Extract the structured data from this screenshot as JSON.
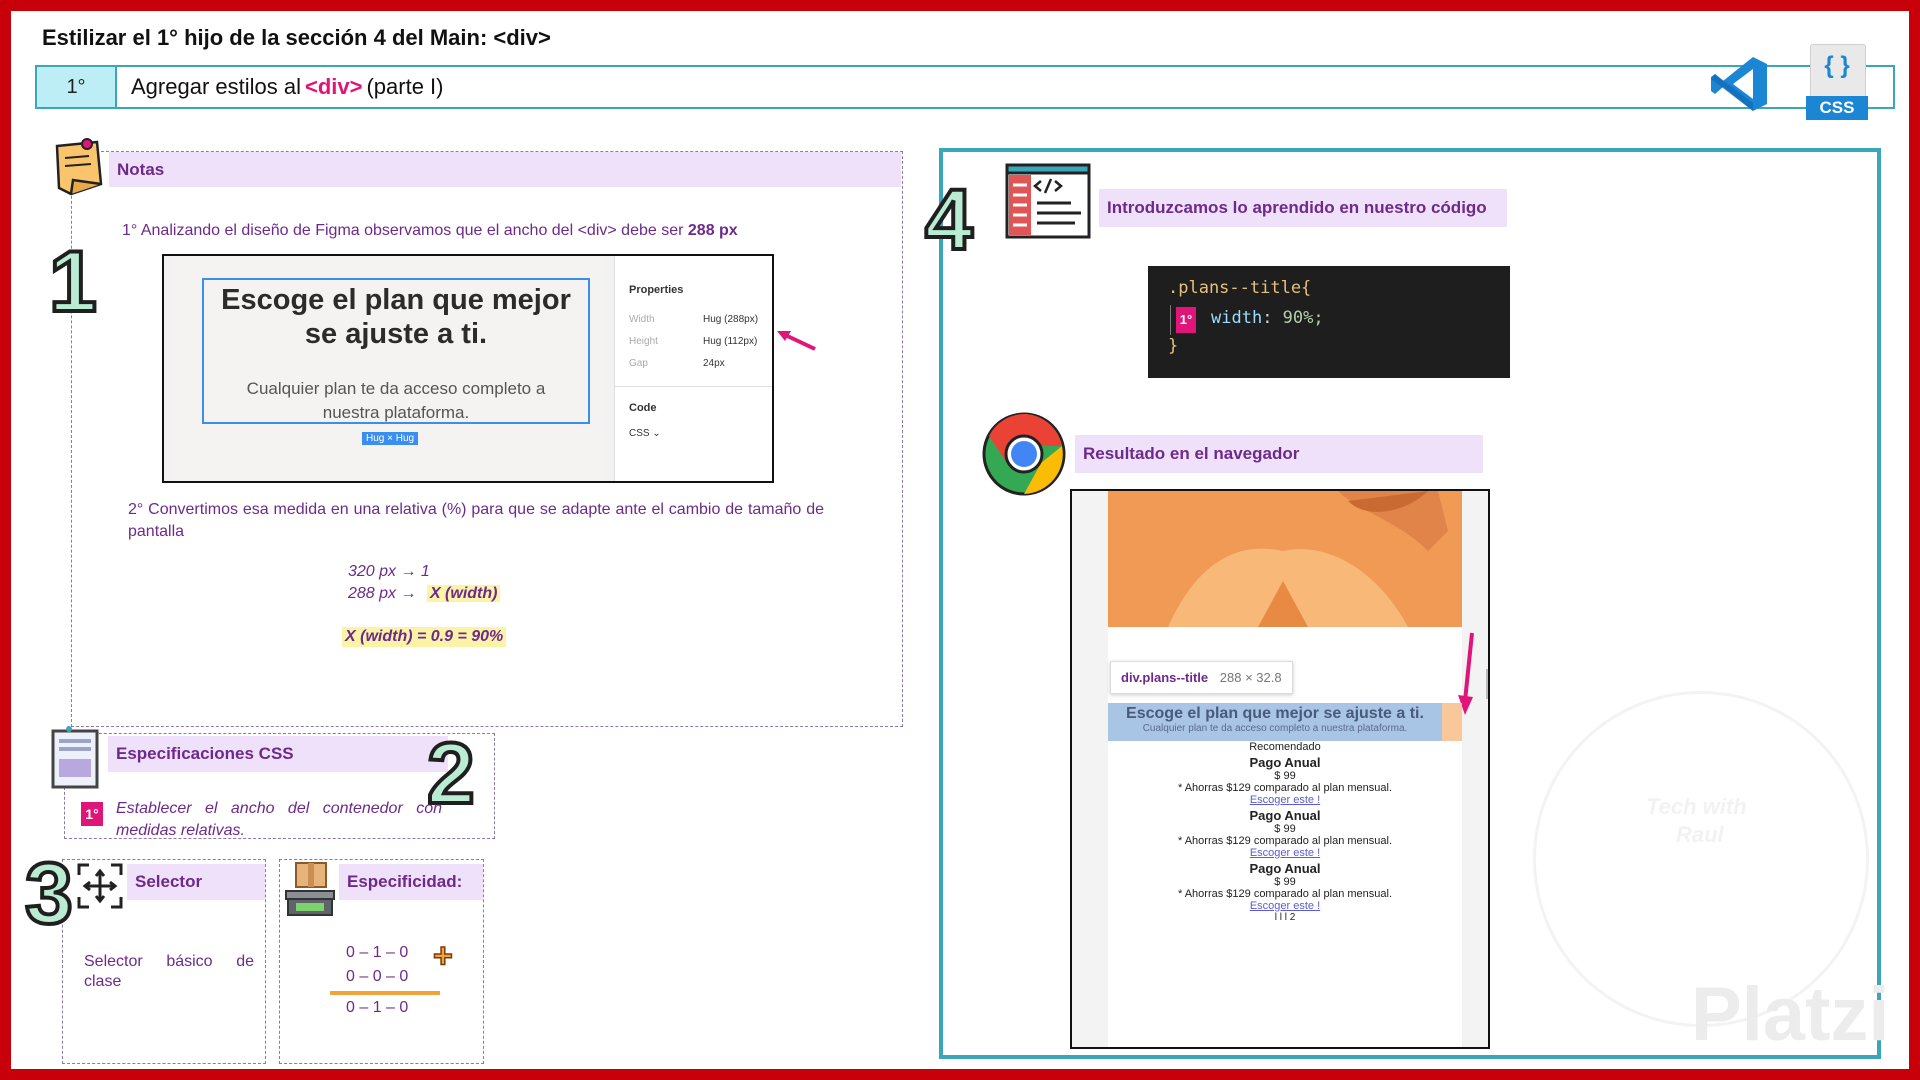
{
  "header": {
    "title": "Estilizar el 1° hijo de la sección 4 del Main: <div>",
    "step": "1°",
    "subtitle_pre": "Agregar estilos al",
    "subtitle_tag": "<div>",
    "subtitle_post": "(parte I)",
    "css_badge": "CSS",
    "css_braces": "{ }"
  },
  "notes": {
    "label": "Notas",
    "section_number": "1",
    "point1": "1° Analizando el diseño de Figma observamos que el ancho del <div> debe ser",
    "point1_value": "288 px",
    "point2": "2° Convertimos esa medida en una relativa (%) para que se adapte ante el cambio de tamaño de pantalla",
    "calc_line1": "320 px → 1",
    "calc_line2_left": "288 px →",
    "calc_line2_right": "X (width)",
    "calc_result": "X (width) = 0.9 = 90%"
  },
  "figma": {
    "heading": "Escoge el plan que mejor se ajuste a ti.",
    "paragraph": "Cualquier plan te da acceso completo a nuestra plataforma.",
    "tag": "Hug × Hug",
    "properties_title": "Properties",
    "width_label": "Width",
    "width_value": "Hug (288px)",
    "height_label": "Height",
    "height_value": "Hug (112px)",
    "gap_label": "Gap",
    "gap_value": "24px",
    "code_title": "Code",
    "code_lang": "CSS ⌄"
  },
  "specs": {
    "label": "Especificaciones CSS",
    "section_number": "2",
    "badge": "1°",
    "text": "Establecer el ancho del contenedor con medidas relativas."
  },
  "selector": {
    "label": "Selector",
    "section_number": "3",
    "text": "Selector básico de clase"
  },
  "specificity": {
    "label": "Especificidad:",
    "row1": "0 – 1 – 0",
    "row2": "0 – 0 – 0",
    "total": "0 – 1 – 0",
    "plus": "+"
  },
  "code_section": {
    "label": "Introduzcamos lo aprendido en nuestro código",
    "section_number": "4",
    "selector": ".plans--title{",
    "badge": "1°",
    "property": "width",
    "value": "90%;",
    "close": "}"
  },
  "browser_section": {
    "label": "Resultado en el navegador",
    "tooltip_name": "div.plans--title",
    "tooltip_size": "288 × 32.8",
    "heading": "Escoge el plan que mejor se ajuste a ti.",
    "paragraph": "Cualquier plan te da acceso completo a nuestra plataforma.",
    "recommended": "Recomendado",
    "plans": [
      {
        "name": "Pago Anual",
        "price": "$ 99",
        "saving": "* Ahorras $129 comparado al plan mensual.",
        "link": "Escoger este !"
      },
      {
        "name": "Pago Anual",
        "price": "$ 99",
        "saving": "* Ahorras $129 comparado al plan mensual.",
        "link": "Escoger este !"
      },
      {
        "name": "Pago Anual",
        "price": "$ 99",
        "saving": "* Ahorras $129 comparado al plan mensual.",
        "link": "Escoger este !"
      }
    ],
    "footer": "l l l 2"
  },
  "watermark": {
    "brand": "Platzi",
    "signature_line1": "Tech with",
    "signature_line2": "Raul"
  },
  "colors": {
    "frame": "#c8000a",
    "teal": "#3aa6b9",
    "purple": "#6d2a8a",
    "pink": "#e0157a",
    "label_bg": "#f0e1fb"
  }
}
